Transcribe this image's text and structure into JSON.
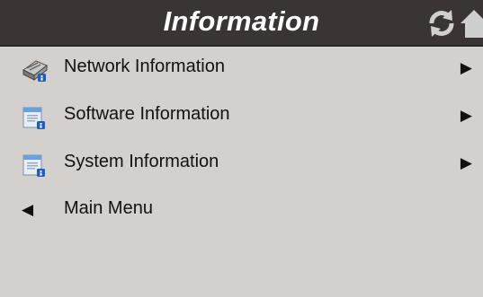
{
  "header": {
    "title": "Information",
    "icons": [
      "refresh-icon",
      "home-icon"
    ]
  },
  "menu": {
    "items": [
      {
        "label": "Network Information",
        "icon": "network-info-icon",
        "arrow": "▶"
      },
      {
        "label": "Software Information",
        "icon": "software-info-icon",
        "arrow": "▶"
      },
      {
        "label": "System Information",
        "icon": "system-info-icon",
        "arrow": "▶"
      }
    ],
    "back": {
      "label": "Main Menu",
      "arrow": "◀"
    }
  },
  "colors": {
    "header_bg": "#3a3434",
    "body_bg": "#d4d0cd",
    "text": "#111111"
  }
}
